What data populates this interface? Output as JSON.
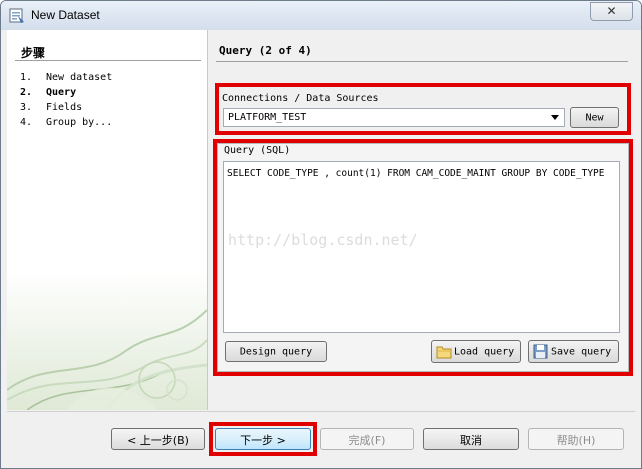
{
  "window": {
    "title": "New Dataset",
    "close_label": "✕"
  },
  "sidebar": {
    "title": "步骤",
    "steps": [
      {
        "num": "1.",
        "label": "New dataset",
        "active": false
      },
      {
        "num": "2.",
        "label": "Query",
        "active": true
      },
      {
        "num": "3.",
        "label": "Fields",
        "active": false
      },
      {
        "num": "4.",
        "label": "Group by...",
        "active": false
      }
    ]
  },
  "main": {
    "page_title": "Query (2 of 4)",
    "connections": {
      "label": "Connections / Data Sources",
      "selected": "PLATFORM_TEST",
      "new_label": "New"
    },
    "query": {
      "label": "Query (SQL)",
      "sql": "SELECT CODE_TYPE , count(1) FROM CAM_CODE_MAINT GROUP BY CODE_TYPE",
      "watermark": "http://blog.csdn.net/",
      "design_label": "Design query",
      "load_label": "Load query",
      "save_label": "Save query"
    }
  },
  "footer": {
    "back_label": "< 上一步(B)",
    "next_label": "下一步 >",
    "finish_label": "完成(F)",
    "cancel_label": "取消",
    "help_label": "帮助(H)"
  },
  "colors": {
    "highlight": "#e00000",
    "sidebar_bg": "#ffffff",
    "dialog_bg": "#f0f0f0"
  }
}
